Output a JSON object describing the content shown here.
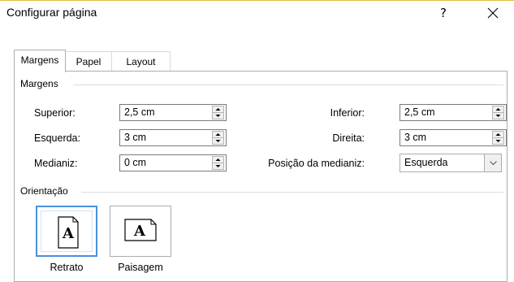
{
  "window": {
    "title": "Configurar página",
    "help_label": "?",
    "close_icon": "close-icon"
  },
  "tabs": [
    {
      "label": "Margens",
      "active": true
    },
    {
      "label": "Papel",
      "active": false
    },
    {
      "label": "Layout",
      "active": false
    }
  ],
  "margins": {
    "group_label": "Margens",
    "superior": {
      "label": "Superior:",
      "value": "2,5 cm"
    },
    "esquerda": {
      "label": "Esquerda:",
      "value": "3 cm"
    },
    "medianiz": {
      "label": "Medianiz:",
      "value": "0 cm"
    },
    "inferior": {
      "label": "Inferior:",
      "value": "2,5 cm"
    },
    "direita": {
      "label": "Direita:",
      "value": "3 cm"
    },
    "posicao_medianiz": {
      "label": "Posição da medianiz:",
      "value": "Esquerda"
    }
  },
  "orientation": {
    "group_label": "Orientação",
    "retrato": {
      "label": "Retrato",
      "selected": true,
      "icon": "portrait-page-icon"
    },
    "paisagem": {
      "label": "Paisagem",
      "selected": false,
      "icon": "landscape-page-icon"
    }
  },
  "colors": {
    "accent": "#4a90d9",
    "title_border": "#e0bf3f"
  }
}
